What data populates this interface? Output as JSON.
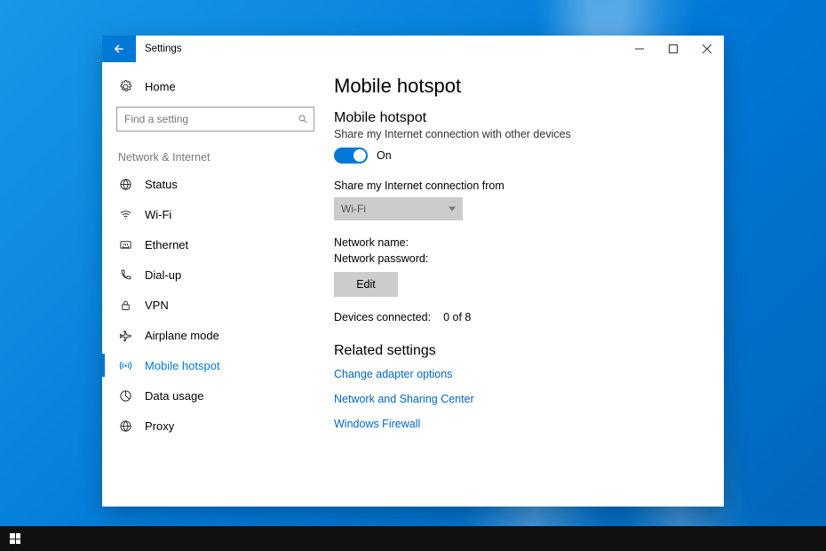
{
  "window": {
    "title": "Settings"
  },
  "sidebar": {
    "home_label": "Home",
    "search_placeholder": "Find a setting",
    "category_label": "Network & Internet",
    "items": [
      {
        "label": "Status"
      },
      {
        "label": "Wi-Fi"
      },
      {
        "label": "Ethernet"
      },
      {
        "label": "Dial-up"
      },
      {
        "label": "VPN"
      },
      {
        "label": "Airplane mode"
      },
      {
        "label": "Mobile hotspot"
      },
      {
        "label": "Data usage"
      },
      {
        "label": "Proxy"
      }
    ]
  },
  "main": {
    "page_title": "Mobile hotspot",
    "section_title": "Mobile hotspot",
    "section_subtitle": "Share my Internet connection with other devices",
    "toggle_state_label": "On",
    "share_from_label": "Share my Internet connection from",
    "share_from_value": "Wi-Fi",
    "network_name_label": "Network name:",
    "network_password_label": "Network password:",
    "edit_button": "Edit",
    "devices_connected_label": "Devices connected:",
    "devices_connected_value": "0 of 8",
    "related_title": "Related settings",
    "links": [
      "Change adapter options",
      "Network and Sharing Center",
      "Windows Firewall"
    ]
  }
}
